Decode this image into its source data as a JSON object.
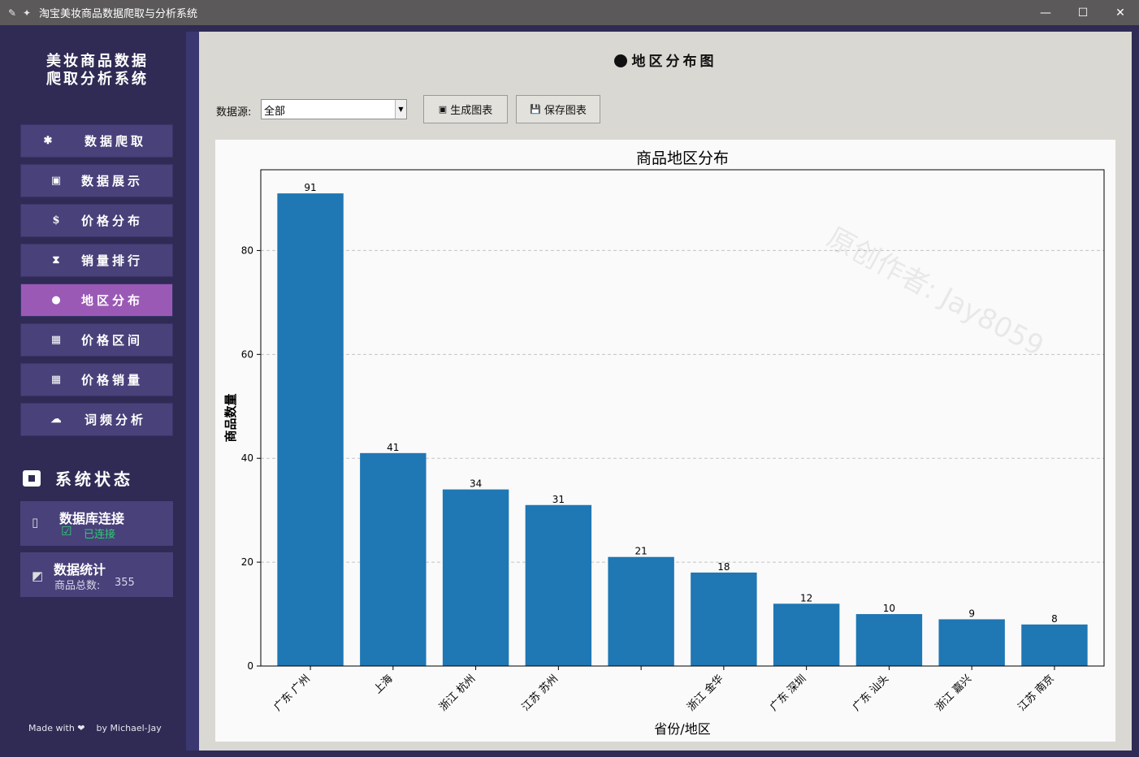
{
  "window": {
    "title": "淘宝美妆商品数据爬取与分析系统",
    "app_icon": "feather-icon",
    "controls": [
      "—",
      "☐",
      "✕"
    ]
  },
  "sidebar": {
    "brand_line1": "美妆商品数据",
    "brand_line2": "爬取分析系统",
    "nav": [
      {
        "icon": "spider-icon",
        "glyph": "✱",
        "label": "数据爬取"
      },
      {
        "icon": "box-icon",
        "glyph": "▣",
        "label": "数据展示"
      },
      {
        "icon": "money-bag-icon",
        "glyph": "$",
        "label": "价格分布"
      },
      {
        "icon": "hourglass-icon",
        "glyph": "⧗",
        "label": "销量排行"
      },
      {
        "icon": "globe-icon",
        "glyph": "●",
        "label": "地区分布",
        "active": true
      },
      {
        "icon": "chart-icon",
        "glyph": "▦",
        "label": "价格区间"
      },
      {
        "icon": "grid-icon",
        "glyph": "▦",
        "label": "价格销量"
      },
      {
        "icon": "cloud-icon",
        "glyph": "☁",
        "label": "词频分析"
      }
    ],
    "status_title": "系统状态",
    "db_card": {
      "title": "数据库连接",
      "check": "☑",
      "status": "已连接"
    },
    "stats_card": {
      "title": "数据统计",
      "label": "商品总数:",
      "count": "355"
    },
    "footer": {
      "made_with": "Made with ❤",
      "by": "by Michael-Jay"
    }
  },
  "main": {
    "title": "地区分布图",
    "source_label": "数据源:",
    "source_value": "全部",
    "generate_button": "生成图表",
    "save_button": "保存图表",
    "watermark": "原创作者: Jay8059"
  },
  "chart_data": {
    "type": "bar",
    "title": "商品地区分布",
    "xlabel": "省份/地区",
    "ylabel": "商品数量",
    "categories": [
      "广东 广州",
      "上海",
      "浙江 杭州",
      "江苏 苏州",
      "",
      "浙江 金华",
      "广东 深圳",
      "广东 汕头",
      "浙江 嘉兴",
      "江苏 南京"
    ],
    "values": [
      91,
      41,
      34,
      31,
      21,
      18,
      12,
      10,
      9,
      8
    ],
    "ylim": [
      0,
      95.55
    ],
    "yticks": [
      0,
      20,
      40,
      60,
      80
    ],
    "grid": "y-dashed",
    "bar_color": "#1f77b4"
  }
}
